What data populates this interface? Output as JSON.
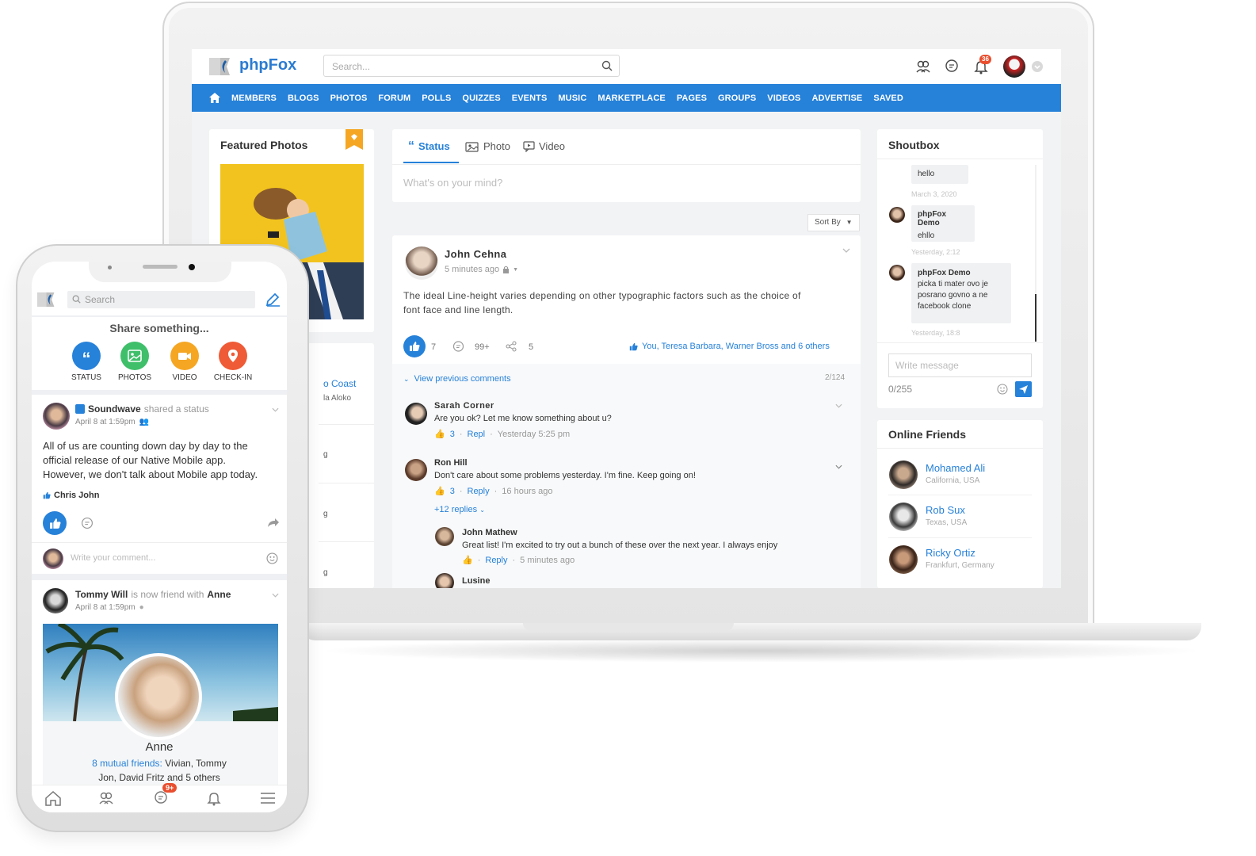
{
  "laptop": {
    "brand": "phpFox",
    "search_placeholder": "Search...",
    "notification_badge": "36",
    "nav_items": [
      "MEMBERS",
      "BLOGS",
      "PHOTOS",
      "FORUM",
      "POLLS",
      "QUIZZES",
      "EVENTS",
      "MUSIC",
      "MARKETPLACE",
      "PAGES",
      "GROUPS",
      "VIDEOS",
      "ADVERTISE",
      "SAVED"
    ],
    "featured": {
      "title": "Featured Photos"
    },
    "left_partial": {
      "coast": "o Coast",
      "aloko": "la Aloko",
      "g1": "g",
      "g2": "g",
      "g3": "g"
    },
    "composer": {
      "tabs": [
        "Status",
        "Photo",
        "Video"
      ],
      "placeholder": "What's on your mind?",
      "sort_by": "Sort By"
    },
    "post": {
      "author": "John Cehna",
      "time": "5 minutes ago",
      "text_line1": "The ideal Line-height varies depending on other typographic factors such as the choice of",
      "text_line2": "font face and line length.",
      "likes": "7",
      "comments": "99+",
      "shares": "5",
      "liked_by": "You, Teresa Barbara, Warner Bross and 6 others",
      "view_previous": "View previous comments",
      "comment_count": "2/124"
    },
    "comments": [
      {
        "name": "Sarah Corner",
        "text": "Are you ok? Let me know something about u?",
        "likes": "3",
        "action": "Repl",
        "time": "Yesterday 5:25 pm"
      },
      {
        "name": "Ron Hill",
        "text": "Don't care about some problems yesterday. I'm fine. Keep going on!",
        "likes": "3",
        "action": "Reply",
        "time": "16 hours ago",
        "replies": "+12 replies"
      },
      {
        "name": "John Mathew",
        "text": "Great list! I'm excited to try out a bunch of these over the next year. I always enjoy",
        "action": "Reply",
        "time": "5 minutes ago"
      },
      {
        "name": "Lusine"
      }
    ],
    "shoutbox": {
      "title": "Shoutbox",
      "messages": [
        {
          "text": "hello",
          "date": "March 3, 2020"
        },
        {
          "name": "phpFox Demo",
          "text": "ehllo",
          "date": "Yesterday, 2:12"
        },
        {
          "name": "phpFox Demo",
          "text_lines": [
            "picka ti mater ovo je",
            "posrano govno a ne",
            "facebook clone"
          ],
          "date": "Yesterday, 18:8"
        }
      ],
      "input_placeholder": "Write message",
      "counter": "0/255"
    },
    "online_friends": {
      "title": "Online Friends",
      "friends": [
        {
          "name": "Mohamed Ali",
          "location": "California, USA"
        },
        {
          "name": "Rob Sux",
          "location": "Texas, USA"
        },
        {
          "name": "Ricky Ortiz",
          "location": "Frankfurt, Germany"
        }
      ]
    }
  },
  "phone": {
    "search_placeholder": "Search",
    "share_title": "Share something...",
    "quick_actions": [
      {
        "label": "STATUS",
        "color": "#2681d9",
        "icon": "quote-icon"
      },
      {
        "label": "PHOTOS",
        "color": "#3fbf6a",
        "icon": "photo-icon"
      },
      {
        "label": "VIDEO",
        "color": "#f5a623",
        "icon": "video-icon"
      },
      {
        "label": "CHECK-IN",
        "color": "#ef5b36",
        "icon": "location-pin-icon"
      }
    ],
    "post1": {
      "author": "Soundwave",
      "action": "shared a status",
      "time": "April 8 at 1:59pm",
      "line1": "All of us are counting down day by day to the",
      "line2": "official release of our Native Mobile app.",
      "line3": "However, we don't talk about Mobile app today.",
      "liked_by": "Chris John",
      "comment_placeholder": "Write your comment..."
    },
    "post2": {
      "author": "Tommy Will",
      "action": "is now friend with",
      "friend": "Anne",
      "time": "April 8 at 1:59pm",
      "card_name": "Anne",
      "mutual_label": "8 mutual friends:",
      "mutual_names_1": "Vivian, Tommy",
      "mutual_names_2": "Jon, David Fritz and 5 others"
    },
    "chat_badge": "9+"
  }
}
